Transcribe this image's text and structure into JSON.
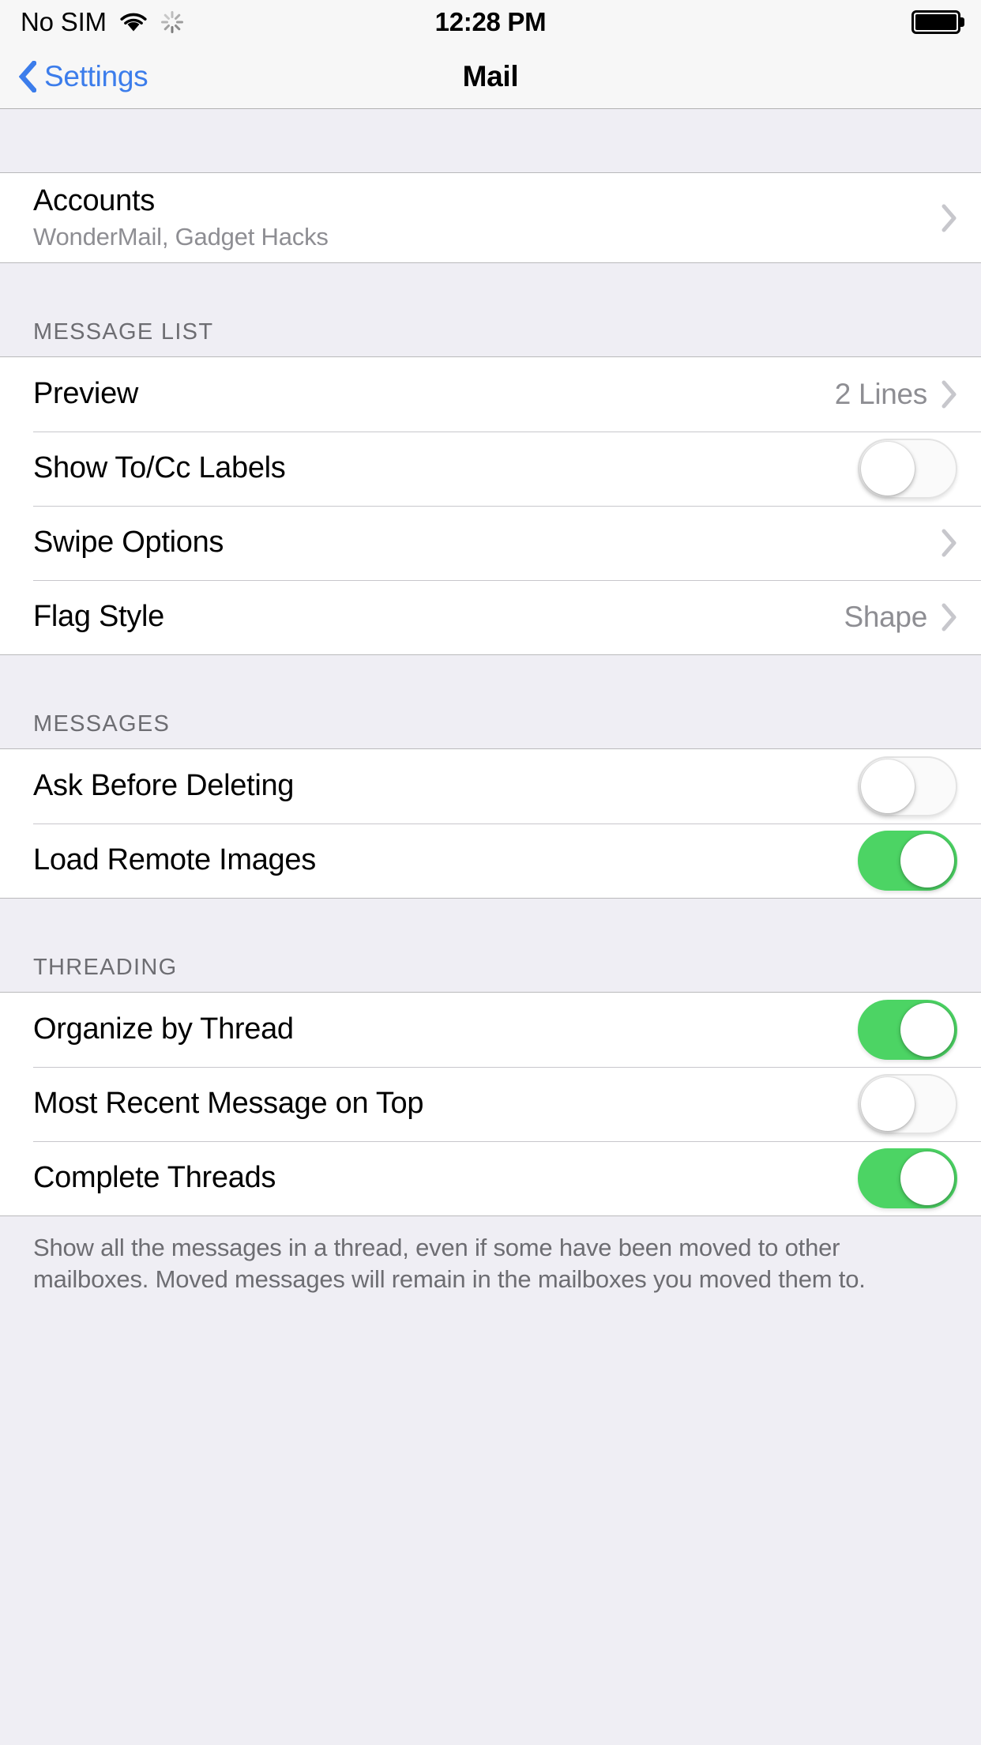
{
  "status_bar": {
    "carrier": "No SIM",
    "time": "12:28 PM",
    "wifi_icon": "wifi-icon",
    "activity_icon": "activity-spinner-icon",
    "battery_icon": "battery-full-icon"
  },
  "nav": {
    "back_label": "Settings",
    "back_icon": "chevron-left-icon",
    "title": "Mail"
  },
  "groups": [
    {
      "header": "",
      "rows": [
        {
          "label": "Accounts",
          "subtitle": "WonderMail, Gadget Hacks",
          "accessory": "chevron",
          "value": ""
        }
      ],
      "footer": ""
    },
    {
      "header": "MESSAGE LIST",
      "rows": [
        {
          "label": "Preview",
          "value": "2 Lines",
          "accessory": "chevron"
        },
        {
          "label": "Show To/Cc Labels",
          "accessory": "switch",
          "switch_on": false
        },
        {
          "label": "Swipe Options",
          "value": "",
          "accessory": "chevron"
        },
        {
          "label": "Flag Style",
          "value": "Shape",
          "accessory": "chevron"
        }
      ],
      "footer": ""
    },
    {
      "header": "MESSAGES",
      "rows": [
        {
          "label": "Ask Before Deleting",
          "accessory": "switch",
          "switch_on": false
        },
        {
          "label": "Load Remote Images",
          "accessory": "switch",
          "switch_on": true
        }
      ],
      "footer": ""
    },
    {
      "header": "THREADING",
      "rows": [
        {
          "label": "Organize by Thread",
          "accessory": "switch",
          "switch_on": true
        },
        {
          "label": "Most Recent Message on Top",
          "accessory": "switch",
          "switch_on": false
        },
        {
          "label": "Complete Threads",
          "accessory": "switch",
          "switch_on": true
        }
      ],
      "footer": "Show all the messages in a thread, even if some have been moved to other mailboxes. Moved messages will remain in the mailboxes you moved them to."
    }
  ],
  "colors": {
    "accent_blue": "#3C7DEB",
    "switch_on_green": "#4CD464",
    "group_background": "#FFFFFF",
    "page_background": "#EFEEF4",
    "secondary_text": "#8E8E93",
    "header_text": "#6D6D72"
  }
}
